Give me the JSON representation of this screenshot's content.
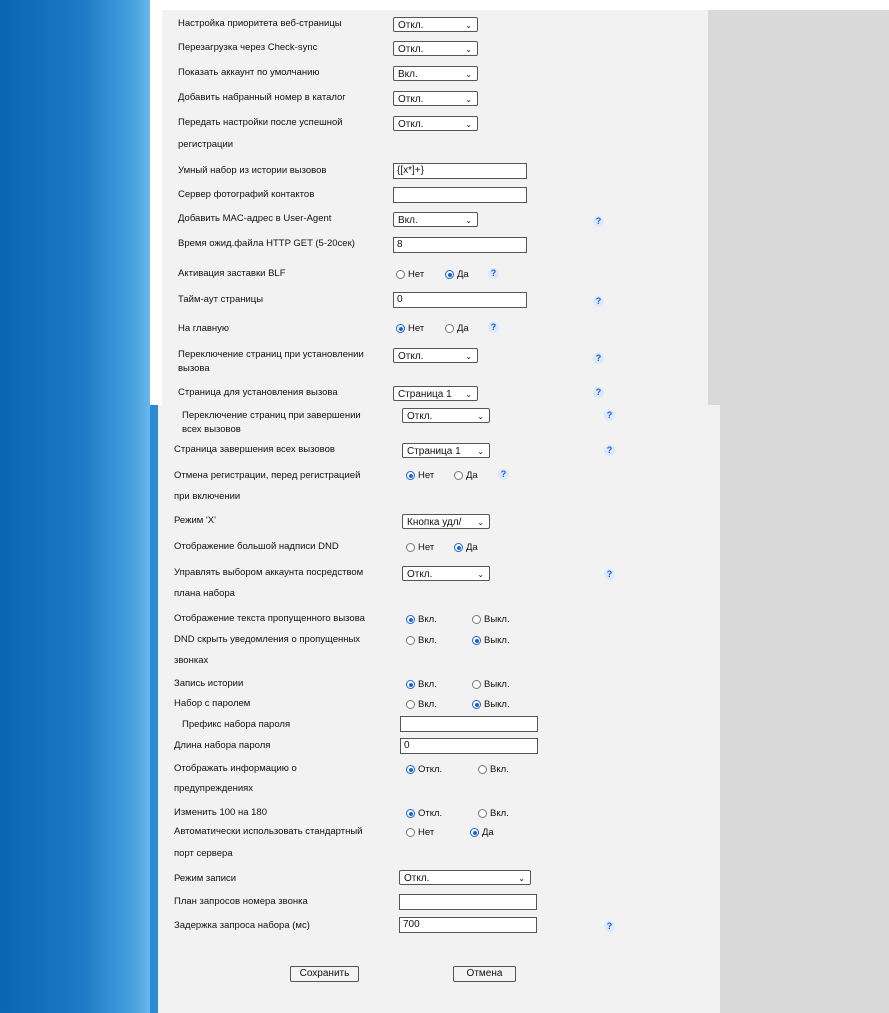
{
  "options": {
    "off": "Откл.",
    "on": "Вкл.",
    "no": "Нет",
    "yes": "Да",
    "page1": "Страница 1",
    "delete_button": "Кнопка удл/",
    "on_lower": "Вкл.",
    "off_lower": "Выкл."
  },
  "help_glyph": "?",
  "s1": {
    "web_priority": "Настройка приоритета веб-страницы",
    "reboot_checksync": "Перезагрузка через Check-sync",
    "show_default_account": "Показать аккаунт по умолчанию",
    "add_dialed_to_catalog": "Добавить набранный номер в каталог",
    "transfer_settings_l1": "Передать настройки после успешной",
    "transfer_settings_l2": "регистрации",
    "smart_dial": "Умный набор из истории вызовов",
    "smart_dial_value": "{[x*]+}",
    "photo_server": "Сервер фотографий контактов",
    "photo_server_value": "",
    "mac_useragent": "Добавить MAC-адрес в User-Agent",
    "http_get_timeout": "Время ожид.файла HTTP GET (5-20сек)",
    "http_get_timeout_value": "8",
    "blf_screensaver": "Активация заставки BLF",
    "page_timeout": "Тайм-аут страницы",
    "page_timeout_value": "0",
    "to_home": "На главную",
    "page_switch_call_l1": "Переключение страниц при установлении",
    "page_switch_call_l2": "вызова",
    "call_setup_page": "Страница для установления вызова"
  },
  "s2": {
    "page_switch_end_l1": "Переключение страниц при завершении",
    "page_switch_end_l2": "всех вызовов",
    "end_calls_page": "Страница завершения всех вызовов",
    "unregister_l1": "Отмена регистрации, перед регистрацией",
    "unregister_l2": "при включении",
    "x_mode": "Режим 'X'",
    "big_dnd": "Отображение большой надписи DND",
    "account_dialplan_l1": "Управлять выбором аккаунта посредством",
    "account_dialplan_l2": "плана набора",
    "missed_text": "Отображение текста пропущенного вызова",
    "dnd_hide_l1": "DND скрыть уведомления о пропущенных",
    "dnd_hide_l2": "звонках",
    "history_record": "Запись истории",
    "password_dial": "Набор с паролем",
    "password_prefix": "Префикс набора пароля",
    "password_prefix_value": "",
    "password_length": "Длина набора пароля",
    "password_length_value": "0",
    "warnings_l1": "Отображать информацию о",
    "warnings_l2": "предупреждениях",
    "change_100_180": "Изменить 100 на 180",
    "auto_port_l1": "Автоматически использовать стандартный",
    "auto_port_l2": "порт сервера",
    "record_mode": "Режим записи",
    "ring_number_plan": "План запросов номера звонка",
    "ring_number_plan_value": "",
    "dial_delay": "Задержка запроса набора (мс)",
    "dial_delay_value": "700"
  },
  "buttons": {
    "save": "Сохранить",
    "cancel": "Отмена"
  }
}
